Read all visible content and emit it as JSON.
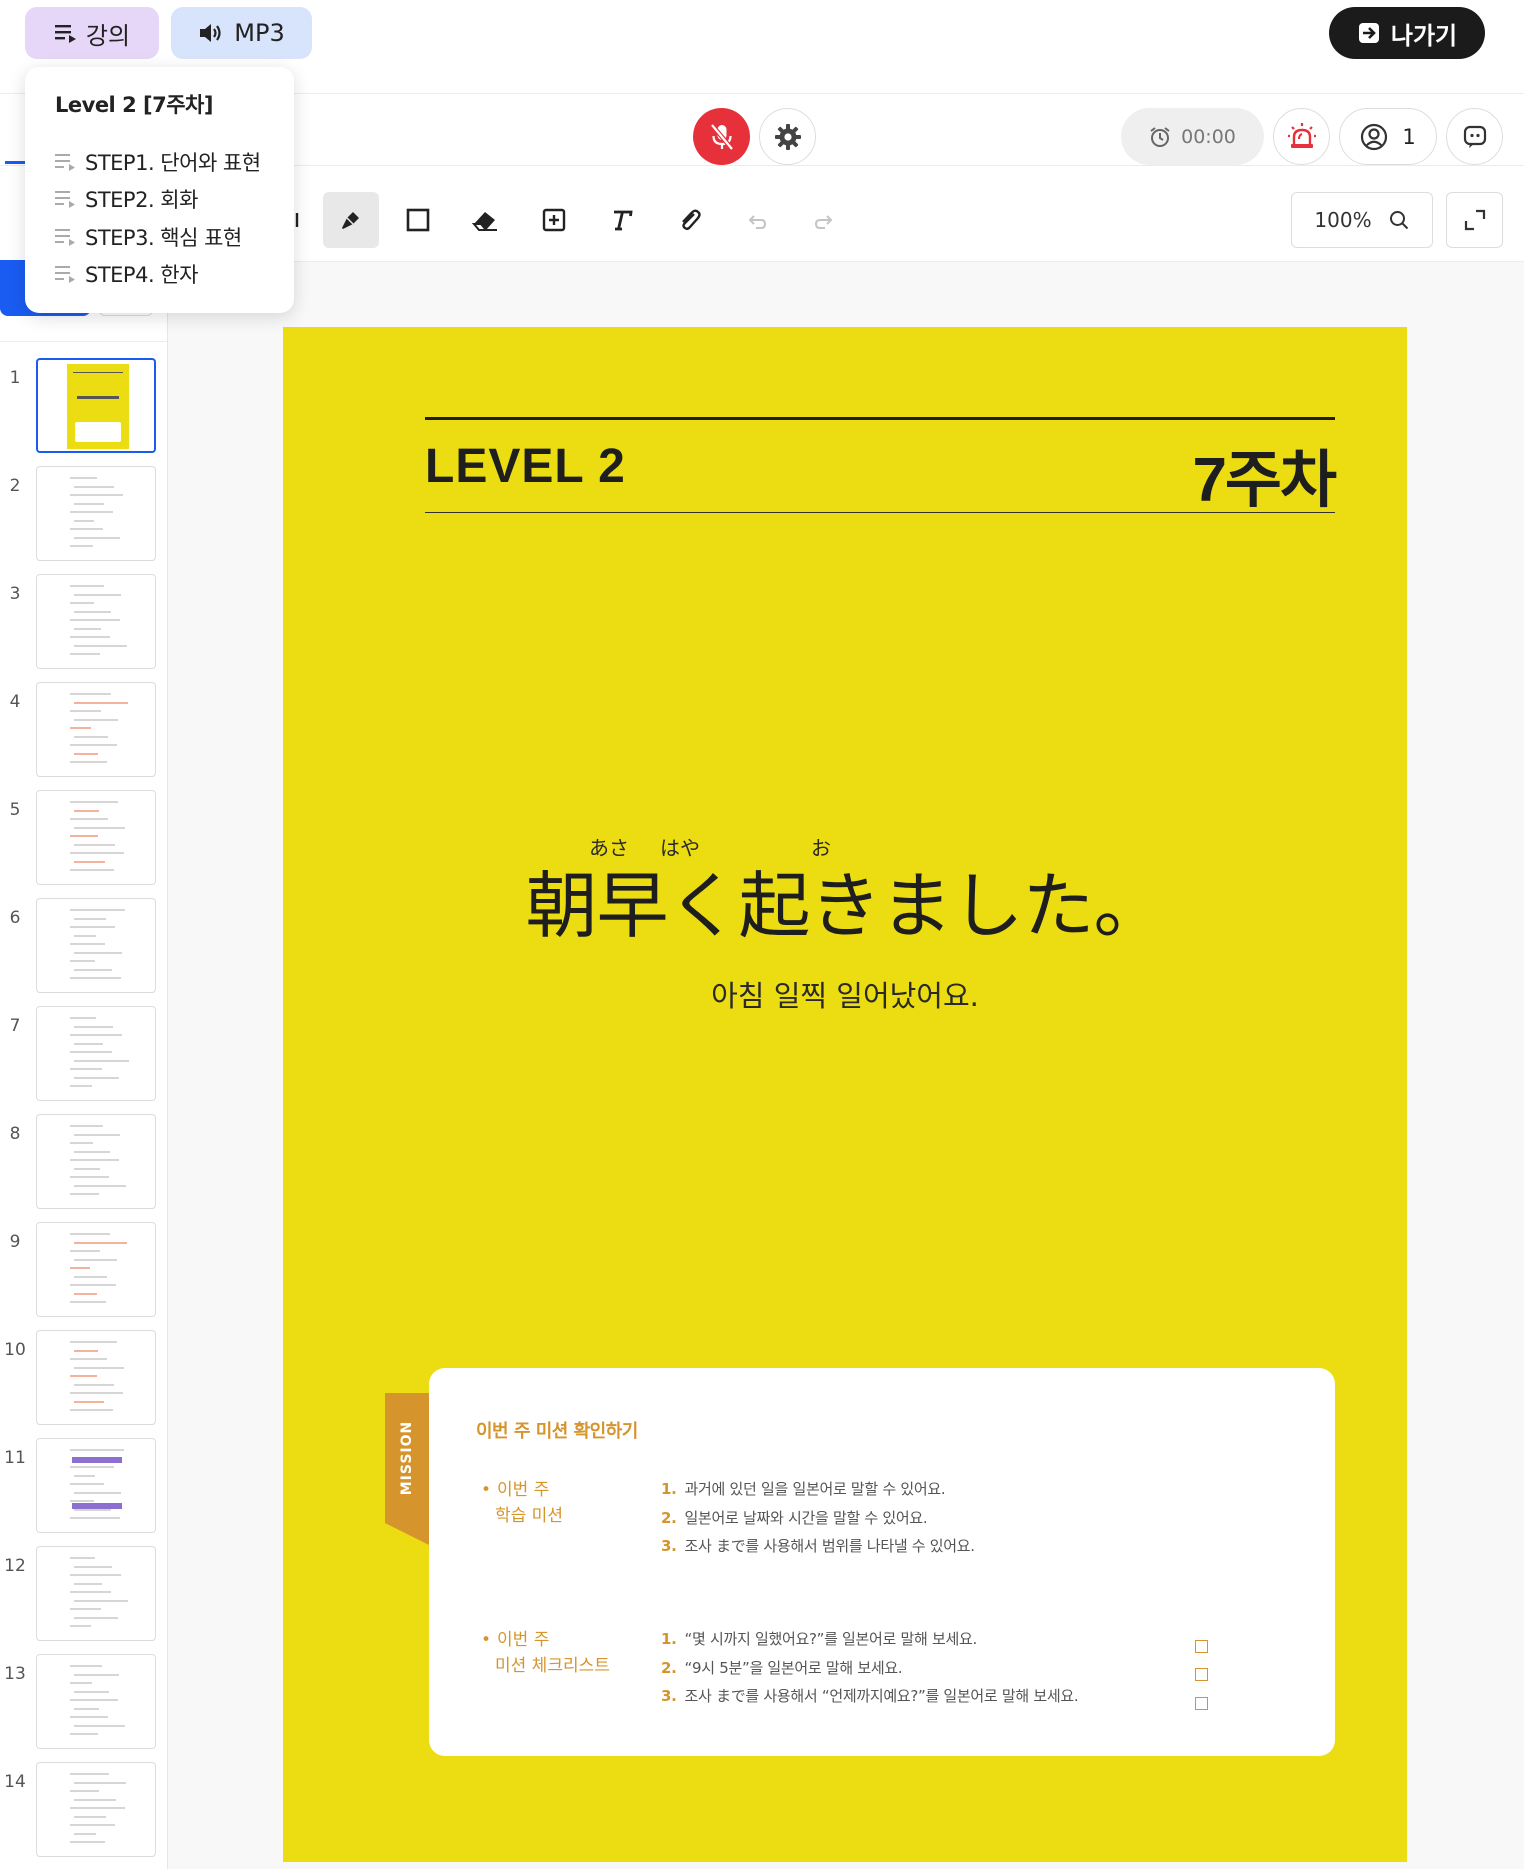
{
  "topbar": {
    "lecture_label": "강의",
    "mp3_label": "MP3",
    "exit_label": "나가기"
  },
  "dropdown": {
    "title": "Level 2 [7주차]",
    "items": [
      {
        "label": "STEP1. 단어와 표현"
      },
      {
        "label": "STEP2. 회화"
      },
      {
        "label": "STEP3. 핵심 표현"
      },
      {
        "label": "STEP4. 한자"
      }
    ]
  },
  "controls": {
    "timer": "00:00",
    "participants": "1"
  },
  "toolbar": {
    "zoom": "100%"
  },
  "sidebar": {
    "thumbnails": [
      {
        "num": "1"
      },
      {
        "num": "2"
      },
      {
        "num": "3"
      },
      {
        "num": "4"
      },
      {
        "num": "5"
      },
      {
        "num": "6"
      },
      {
        "num": "7"
      },
      {
        "num": "8"
      },
      {
        "num": "9"
      },
      {
        "num": "10"
      },
      {
        "num": "11"
      },
      {
        "num": "12"
      },
      {
        "num": "13"
      },
      {
        "num": "14"
      }
    ],
    "selected": 1
  },
  "slide": {
    "level": "LEVEL 2",
    "week": "7주차",
    "furigana": [
      "あさ",
      "はや",
      "お"
    ],
    "japanese": "朝早く起きました。",
    "korean": "아침 일찍 일어났어요.",
    "background_color": "#ecdc12",
    "accent_color": "#d6952c",
    "mission": {
      "tab": "MISSION",
      "title": "이번 주 미션 확인하기",
      "learning_label_1": "이번 주",
      "learning_label_2": "학습 미션",
      "learning": [
        {
          "n": "1.",
          "text": "과거에 있던 일을 일본어로 말할 수 있어요."
        },
        {
          "n": "2.",
          "text": "일본어로 날짜와 시간을 말할 수 있어요."
        },
        {
          "n": "3.",
          "text": "조사 まで를 사용해서 범위를 나타낼 수 있어요."
        }
      ],
      "checklist_label_1": "이번 주",
      "checklist_label_2": "미션 체크리스트",
      "checklist": [
        {
          "n": "1.",
          "text": "“몇 시까지 일했어요?”를 일본어로 말해 보세요."
        },
        {
          "n": "2.",
          "text": "“9시 5분”을 일본어로 말해 보세요."
        },
        {
          "n": "3.",
          "text": "조사 まで를 사용해서 “언제까지예요?”를 일본어로 말해 보세요."
        }
      ]
    }
  }
}
